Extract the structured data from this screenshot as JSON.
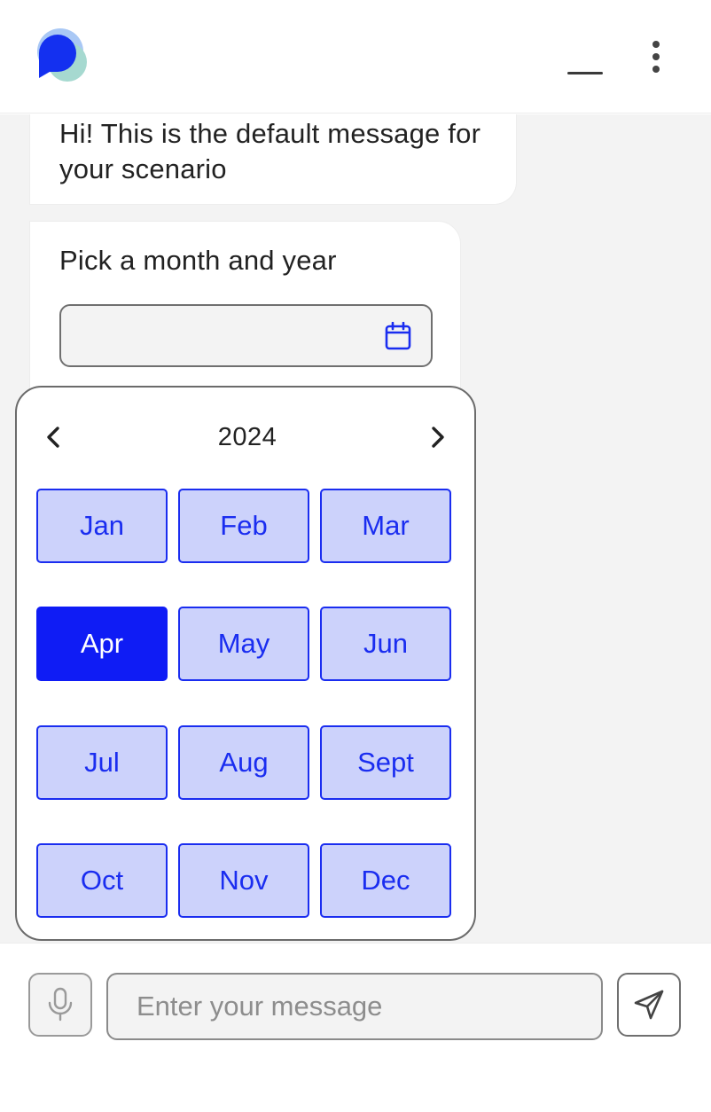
{
  "header": {
    "logo": "chat-bubble-logo",
    "minimize_icon": "minimize-icon",
    "menu_icon": "more-vertical-icon"
  },
  "messages": [
    {
      "text": "Hi! This is the default message for your scenario"
    },
    {
      "text": "Pick a month and year",
      "input_value": ""
    }
  ],
  "picker": {
    "year": "2024",
    "prev_icon": "chevron-left-icon",
    "next_icon": "chevron-right-icon",
    "months": [
      "Jan",
      "Feb",
      "Mar",
      "Apr",
      "May",
      "Jun",
      "Jul",
      "Aug",
      "Sept",
      "Oct",
      "Nov",
      "Dec"
    ],
    "selected": "Apr"
  },
  "composer": {
    "placeholder": "Enter your message",
    "mic_icon": "microphone-icon",
    "send_icon": "send-icon"
  },
  "colors": {
    "accent": "#0f1cf5",
    "month_bg": "#ccd2fb",
    "chat_bg": "#f3f3f3"
  }
}
